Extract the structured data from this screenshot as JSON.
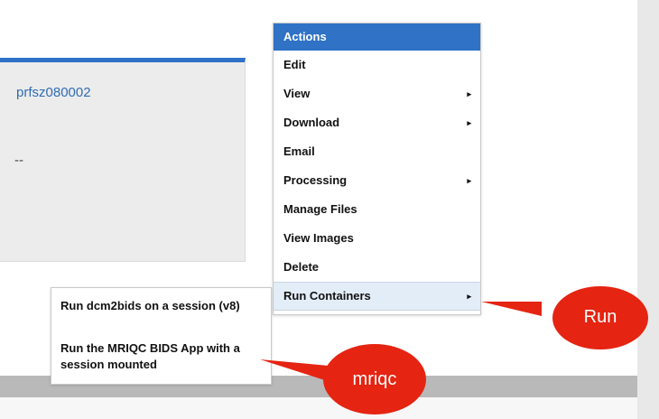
{
  "info": {
    "subject_link": "prfsz080002",
    "dashes": "--"
  },
  "actions_menu": {
    "title": "Actions",
    "items": [
      {
        "label": "Edit",
        "has_submenu": false
      },
      {
        "label": "View",
        "has_submenu": true
      },
      {
        "label": "Download",
        "has_submenu": true
      },
      {
        "label": "Email",
        "has_submenu": false
      },
      {
        "label": "Processing",
        "has_submenu": true
      },
      {
        "label": "Manage Files",
        "has_submenu": false
      },
      {
        "label": "View Images",
        "has_submenu": false
      },
      {
        "label": "Delete",
        "has_submenu": false
      },
      {
        "label": "Run Containers",
        "has_submenu": true,
        "highlighted": true
      }
    ],
    "submenu_arrow": "▸"
  },
  "run_containers_submenu": {
    "items": [
      {
        "label": "Run dcm2bids on a session (v8)"
      },
      {
        "label": "Run the MRIQC BIDS App with a session mounted"
      }
    ]
  },
  "annotations": {
    "run_callout": "Run",
    "mriqc_callout": "mriqc",
    "callout_color": "#e52412"
  },
  "colors": {
    "accent": "#2f72c6",
    "link": "#2e6db3",
    "highlight": "#e3edf7"
  }
}
